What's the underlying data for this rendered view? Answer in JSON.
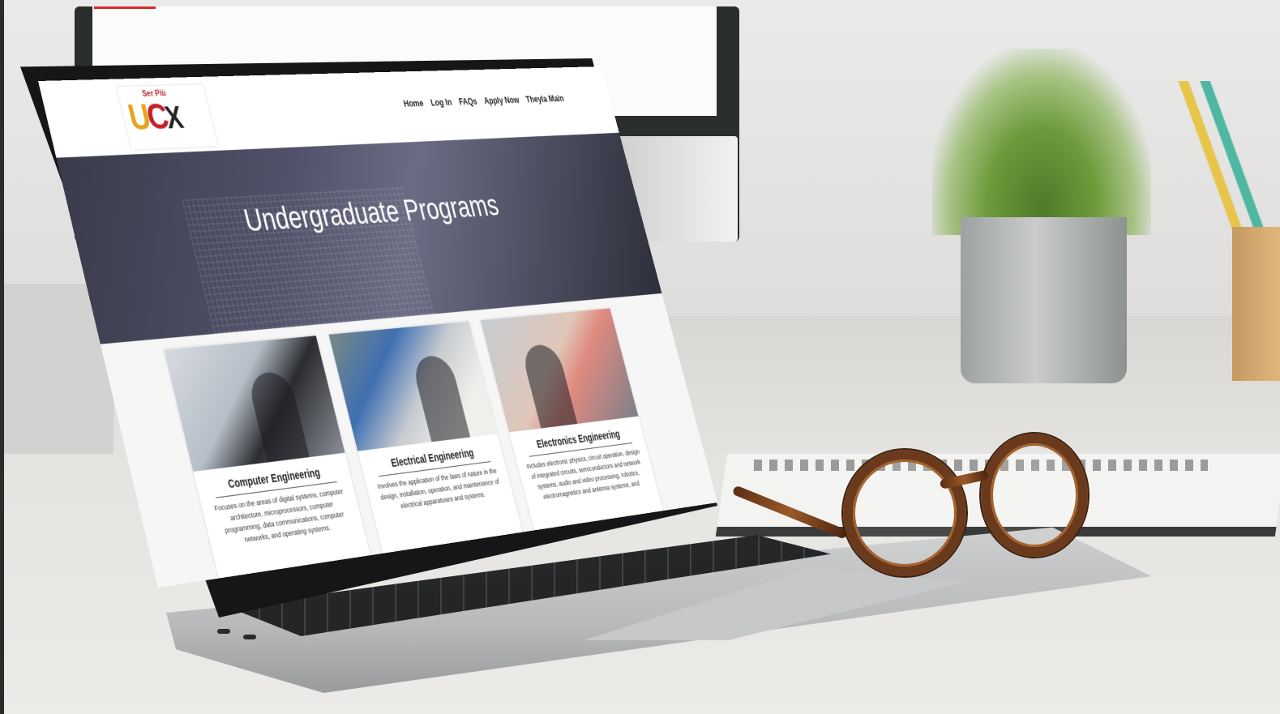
{
  "site": {
    "logo": {
      "top_text": "Ser Più",
      "mark_u": "U",
      "mark_c": "C",
      "mark_x": "X"
    },
    "nav": [
      "Home",
      "Log In",
      "FAQs",
      "Apply Now",
      "Theyla Main"
    ],
    "hero_title": "Undergraduate Programs",
    "cards": [
      {
        "title": "Computer Engineering",
        "description": "Focuses on the areas of digital systems, computer architecture, microprocessors, computer programming, data communications, computer networks, and operating systems."
      },
      {
        "title": "Electrical Engineering",
        "description": "Involves the application of the laws of nature in the design, installation, operation, and maintenance of electrical apparatuses and systems."
      },
      {
        "title": "Electronics Engineering",
        "description": "Includes electronic physics, circuit operation, design of integrated circuits, semiconductors and network systems, audio and video processing, robotics, electromagnetics and antenna systems, and"
      }
    ]
  }
}
